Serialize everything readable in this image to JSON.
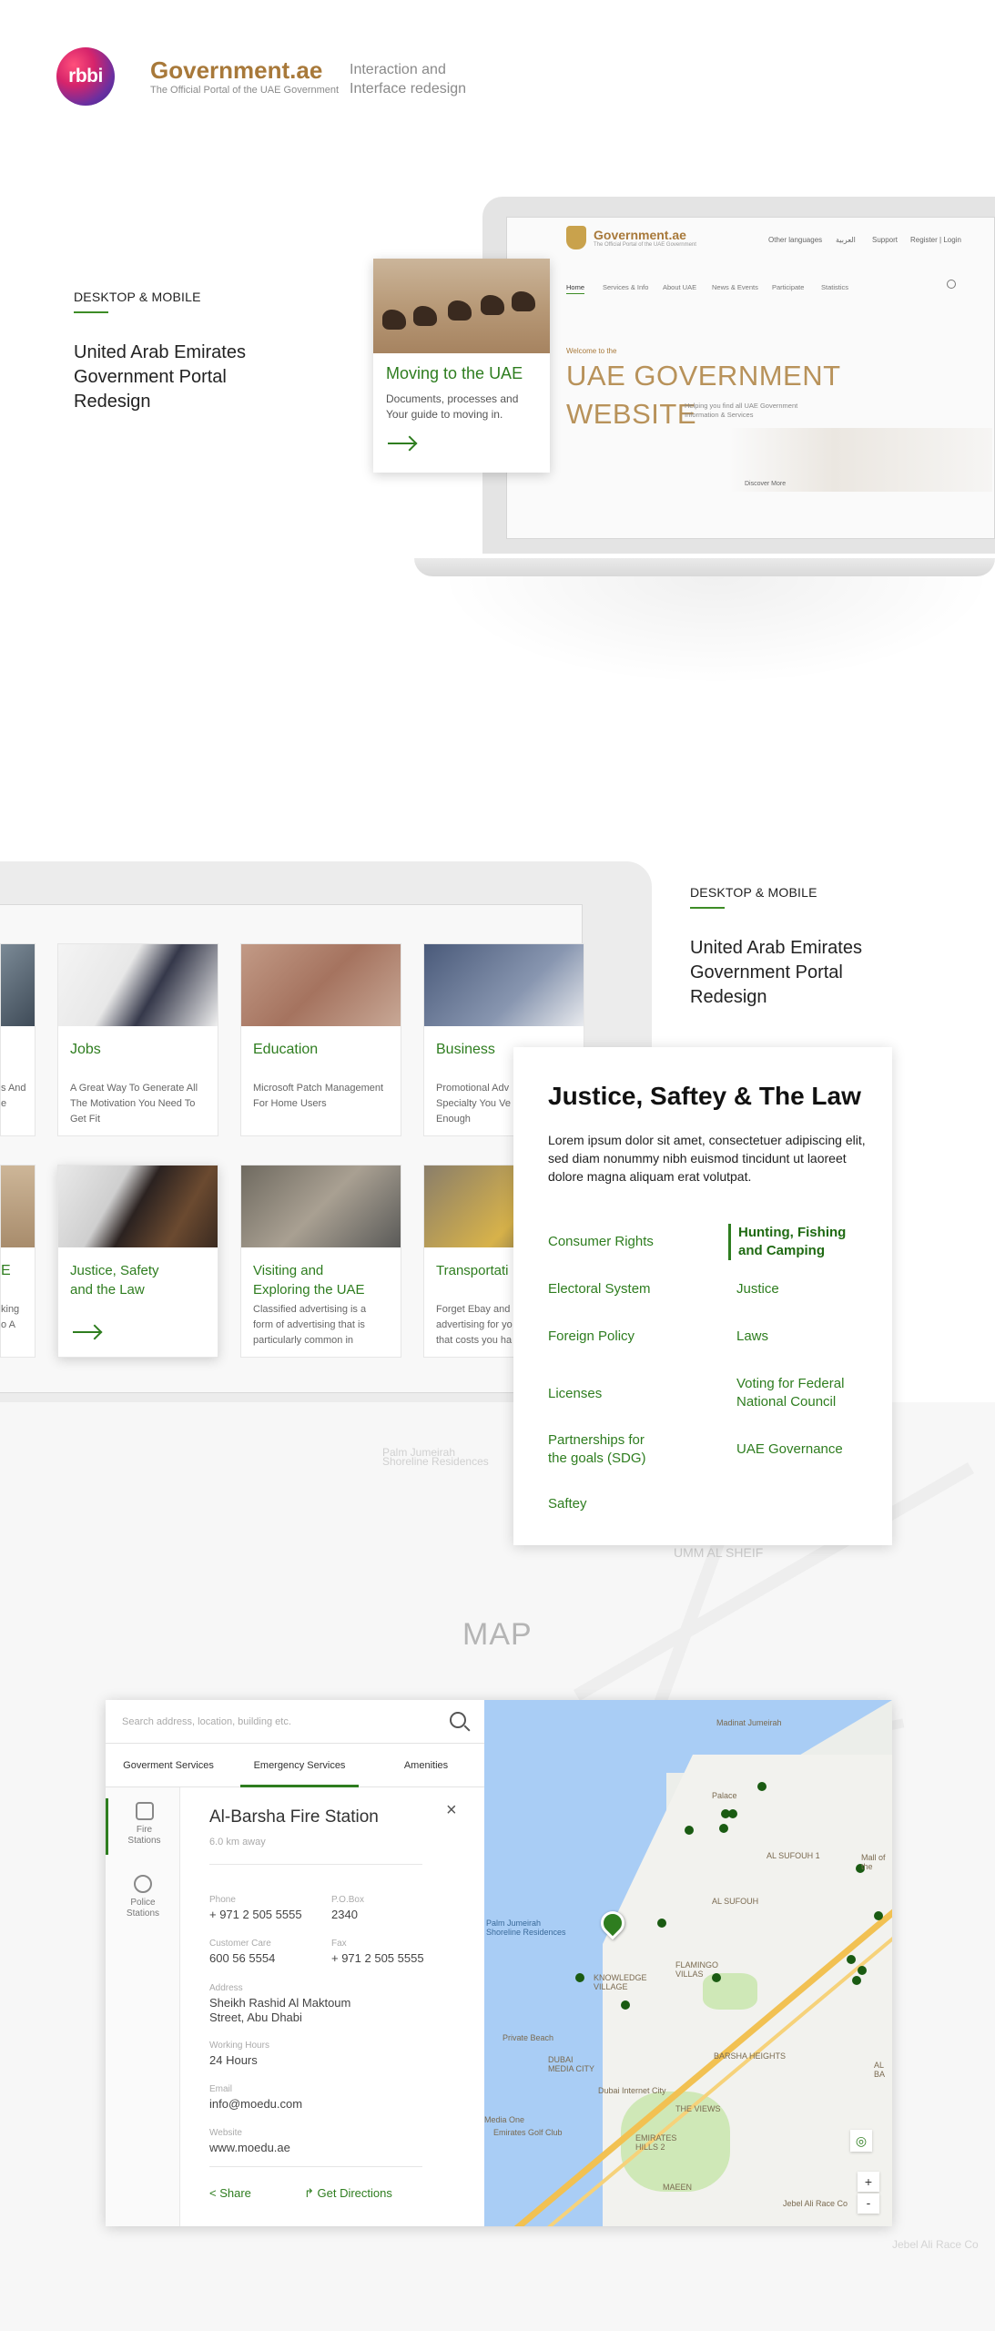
{
  "header": {
    "brand_logo_text": "rbbi",
    "gov_name": "Government.ae",
    "gov_subtitle": "The Official Portal of the UAE Government",
    "note_line1": "Interaction and",
    "note_line2": "Interface redesign"
  },
  "section1": {
    "label": "DESKTOP & MOBILE",
    "title_lines": [
      "United Arab Emirates",
      "Government Portal",
      "Redesign"
    ]
  },
  "website": {
    "logo": "Government.ae",
    "logo_sub": "The Official Portal of the UAE Government",
    "top_nav": [
      "Other languages",
      "العربية",
      "Support",
      "Register | Login"
    ],
    "main_nav": [
      "Home",
      "Services & Info",
      "About UAE",
      "News & Events",
      "Participate",
      "Statistics"
    ],
    "welcome": "Welcome to the",
    "hero_line1": "UAE GOVERNMENT",
    "hero_line2": "WEBSITE",
    "hero_sub": "Helping you find all UAE Government Information & Services",
    "discover": "Discover More"
  },
  "moving_card": {
    "title": "Moving to the UAE",
    "desc": "Documents, processes and Your guide to moving in."
  },
  "section2": {
    "label": "DESKTOP & MOBILE",
    "title_lines": [
      "United Arab Emirates",
      "Government Portal",
      "Redesign"
    ]
  },
  "tiles_row1": [
    {
      "title": "",
      "desc": "s And\ne"
    },
    {
      "title": "Jobs",
      "desc": "A Great Way To Generate All\nThe Motivation You Need To\nGet Fit"
    },
    {
      "title": "Education",
      "desc": "Microsoft Patch Management\nFor Home Users"
    },
    {
      "title": "Business",
      "desc": "Promotional Adv\nSpecialty You Ve\nEnough"
    }
  ],
  "tiles_row2": [
    {
      "title": "E",
      "desc": "king\no A"
    },
    {
      "title": "Justice, Safety\nand the Law",
      "desc": ""
    },
    {
      "title": "Visiting and\nExploring the UAE",
      "desc": "Classified advertising is a\nform of advertising that is\nparticularly common in"
    },
    {
      "title": "Transportati",
      "desc": "Forget Ebay and\nadvertising for yo\nthat costs you ha"
    }
  ],
  "justice": {
    "title": "Justice, Saftey & The Law",
    "lorem": "Lorem ipsum dolor sit amet, consectetuer adipiscing elit, sed diam nonummy nibh euismod tincidunt ut laoreet dolore magna aliquam erat volutpat.",
    "left_links": [
      "Consumer Rights",
      "Electoral System",
      "Foreign Policy",
      "Licenses",
      "Partnerships for\nthe goals (SDG)",
      "Saftey"
    ],
    "right_links": [
      "Hunting, Fishing\nand Camping",
      "Justice",
      "Laws",
      "Voting for Federal\nNational Council",
      "UAE Governance"
    ]
  },
  "map_section": {
    "label": "MAP",
    "bg_labels": [
      "Palm Jumeirah\nShoreline Residences",
      "Dubai Internet City",
      "UMM AL SHEIF",
      "Mall of the",
      "Jebel Ali Race Co"
    ]
  },
  "map_panel": {
    "search_placeholder": "Search address, location, building etc.",
    "tabs": [
      "Goverment Services",
      "Emergency Services",
      "Amenities"
    ],
    "rail": [
      "Fire\nStations",
      "Police\nStations"
    ],
    "station_name": "Al-Barsha Fire Station",
    "distance": "6.0 km away",
    "phone_label": "Phone",
    "phone_value": "+ 971 2 505 5555",
    "pobox_label": "P.O.Box",
    "pobox_value": "2340",
    "care_label": "Customer Care",
    "care_value": "600 56 5554",
    "fax_label": "Fax",
    "fax_value": "+ 971 2 505 5555",
    "address_label": "Address",
    "address_value": "Sheikh Rashid Al Maktoum\nStreet, Abu Dhabi",
    "hours_label": "Working Hours",
    "hours_value": "24 Hours",
    "email_label": "Email",
    "email_value": "info@moedu.com",
    "website_label": "Website",
    "website_value": "www.moedu.ae",
    "share": "Share",
    "directions": "Get Directions",
    "map_labels": [
      "Madinat Jumeirah",
      "Palace",
      "AL SUFOUH 1",
      "Mall of the",
      "AL SUFOUH",
      "Palm Jumeirah\nShoreline Residences",
      "FLAMINGO\nVILLAS",
      "KNOWLEDGE\nVILLAGE",
      "Private Beach",
      "DUBAI\nMEDIA CITY",
      "BARSHA HEIGHTS",
      "Dubai Internet City",
      "Media One",
      "Emirates Golf Club",
      "THE VIEWS",
      "EMIRATES\nHILLS 2",
      "MAEEN",
      "Jebel Ali Race Co",
      "AL BA"
    ]
  },
  "colors": {
    "accent_green": "#2e7d1f",
    "gold": "#a8793a"
  }
}
